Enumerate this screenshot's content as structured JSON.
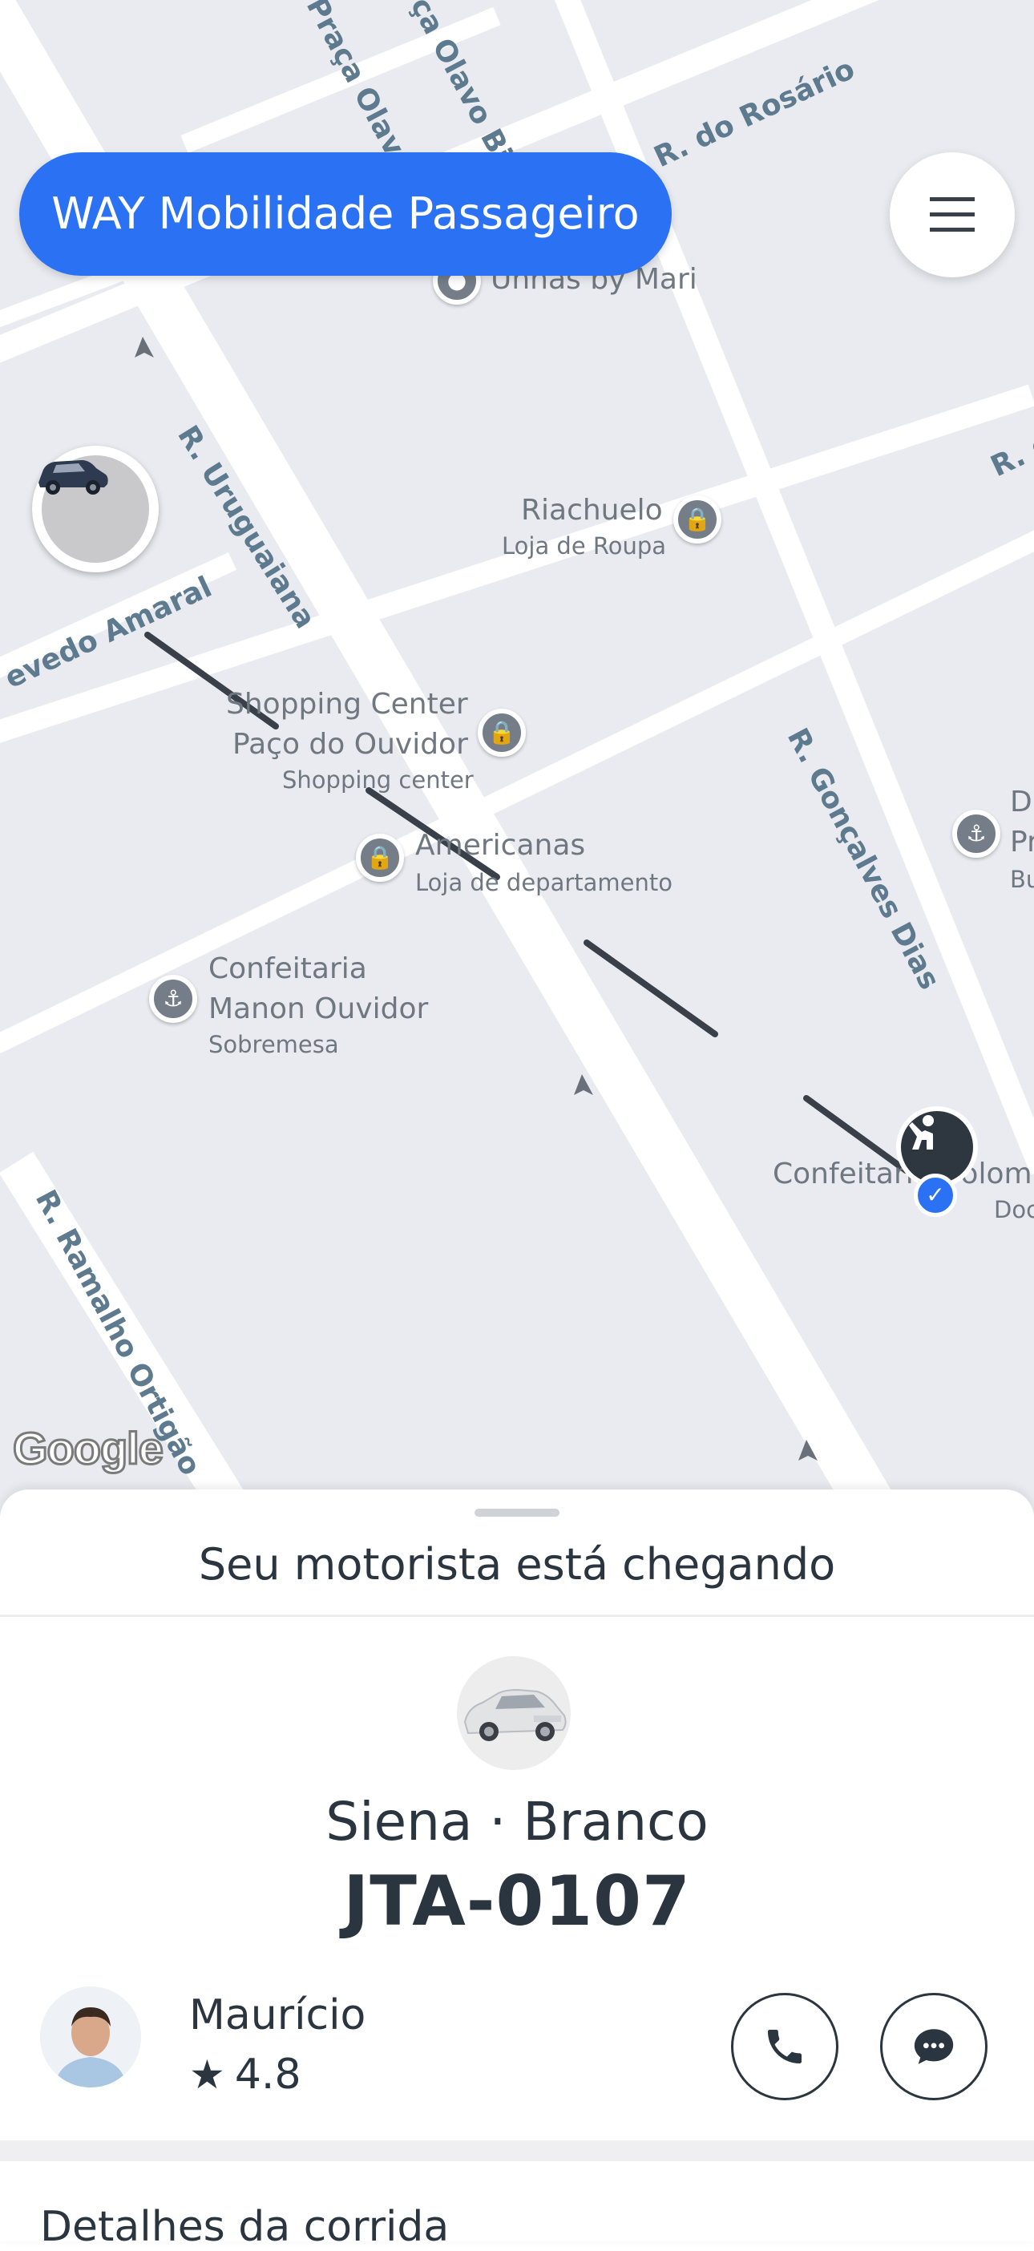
{
  "app": {
    "title": "WAY Mobilidade Passageiro"
  },
  "map": {
    "streets": [
      {
        "name": "Praça Olavo B"
      },
      {
        "name": "ça Olavo Bilac"
      },
      {
        "name": "R. do Rosário"
      },
      {
        "name": "R. d"
      },
      {
        "name": "R. Uruguaiana"
      },
      {
        "name": "evedo Amaral"
      },
      {
        "name": "R. Gonçalves Dias"
      },
      {
        "name": "R. Ramalho Ortigão"
      }
    ],
    "pois": [
      {
        "name": "Unhas by Mari",
        "sub": ""
      },
      {
        "name": "Riachuelo",
        "sub": "Loja de Roupa"
      },
      {
        "name": "Shopping Center",
        "name2": "Paço do Ouvidor",
        "sub": "Shopping center"
      },
      {
        "name": "Americanas",
        "sub": "Loja de departamento"
      },
      {
        "name": "Confeitaria",
        "name2": "Manon Ouvidor",
        "sub": "Sobremesa"
      },
      {
        "name": "Confeitaria Colomb",
        "sub": "Doc"
      },
      {
        "name": "D",
        "name2": "Pr",
        "sub": "Bu"
      }
    ],
    "attribution": "Google"
  },
  "sheet": {
    "status": "Seu motorista está chegando",
    "vehicle": {
      "model": "Siena · Branco",
      "plate": "JTA-0107"
    },
    "driver": {
      "name": "Maurício",
      "rating": "4.8"
    },
    "details_title": "Detalhes da corrida"
  },
  "colors": {
    "brand": "#2a72f3",
    "map_bg": "#e9ebf0",
    "route": "#3a404a",
    "text": "#2b3540"
  },
  "icons": {
    "menu": "hamburger-menu-icon",
    "call": "phone-icon",
    "chat": "chat-bubble-icon",
    "star": "star-icon"
  }
}
